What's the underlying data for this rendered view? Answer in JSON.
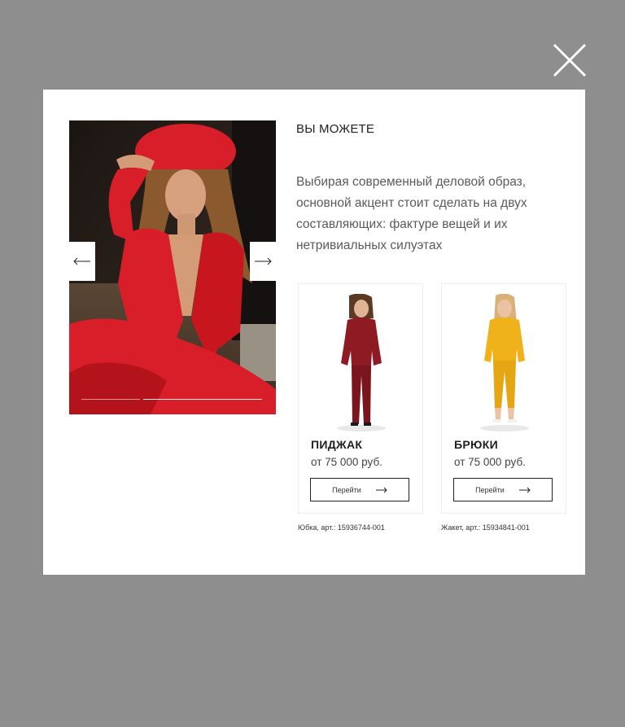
{
  "modal": {
    "heading": "ВЫ МОЖЕТЕ",
    "description": "Выбирая современный деловой образ, основной акцент стоит сделать на двух составляющих: фактуре вещей и их нетривиальных силуэтах"
  },
  "gallery": {
    "prev_icon": "arrow-left-icon",
    "next_icon": "arrow-right-icon",
    "slide_progress_fraction": 0.33
  },
  "products": [
    {
      "name": "ПИДЖАК",
      "price": "от 75 000 руб.",
      "button_label": "Перейти",
      "article": "Юбка, арт.: 15936744-001",
      "color": "#8e1a24"
    },
    {
      "name": "БРЮКИ",
      "price": "от 75 000 руб.",
      "button_label": "Перейти",
      "article": "Жакет, арт.: 15934841-001",
      "color": "#f0b21b"
    }
  ],
  "colors": {
    "overlay": "#8e8e8e",
    "modal": "#ffffff",
    "accent_red": "#d81e28"
  },
  "icons": {
    "close": "close-icon",
    "button_arrow": "arrow-right-icon"
  }
}
